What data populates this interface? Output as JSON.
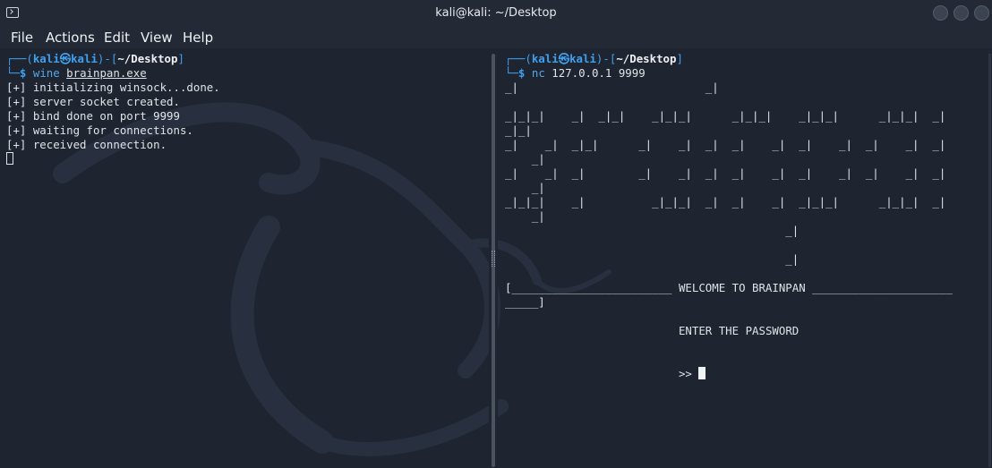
{
  "window": {
    "title": "kali@kali: ~/Desktop"
  },
  "menu": [
    "File",
    "Actions",
    "Edit",
    "View",
    "Help"
  ],
  "prompt": {
    "user": "kali",
    "at": "㉿",
    "host": "kali",
    "path": "~/Desktop",
    "symbol": "$"
  },
  "left_pane": {
    "command": "wine",
    "argument": "brainpan.exe",
    "output": [
      "[+] initializing winsock...done.",
      "[+] server socket created.",
      "[+] bind done on port 9999",
      "[+] waiting for connections.",
      "[+] received connection."
    ]
  },
  "right_pane": {
    "command": "nc",
    "args": "127.0.0.1 9999",
    "banner": [
      "_|                            _|",
      "",
      "_|_|_|    _|  _|_|    _|_|_|      _|_|_|    _|_|_|      _|_|_|  _|",
      "_|_|",
      "_|    _|  _|_|      _|    _|  _|  _|    _|  _|    _|  _|    _|  _|",
      "    _|",
      "_|    _|  _|        _|    _|  _|  _|    _|  _|    _|  _|    _|  _|",
      "    _|",
      "_|_|_|    _|          _|_|_|  _|  _|    _|  _|_|_|      _|_|_|  _|",
      "    _|",
      "                                          _|",
      "",
      "                                          _|"
    ],
    "welcome": [
      "[________________________ WELCOME TO BRAINPAN _____________________",
      "_____]"
    ],
    "enter_password": "ENTER THE PASSWORD",
    "input_prompt": ">>"
  }
}
